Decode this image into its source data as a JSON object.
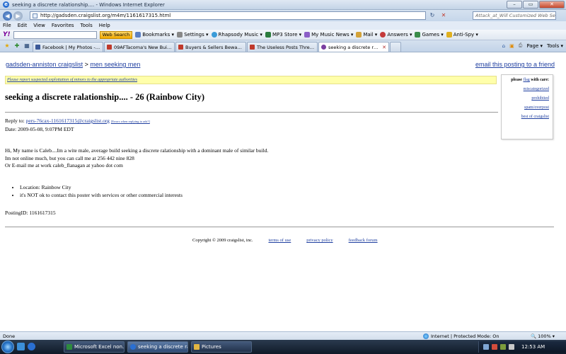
{
  "window": {
    "title": "seeking a discrete ralationship.... - Windows Internet Explorer",
    "min": "–",
    "max": "▭",
    "close": "✕"
  },
  "address": {
    "url": "http://gadsden.craigslist.org/m4m/1161617315.html",
    "search_placeholder": "Attack_at_Will Customized Web Search"
  },
  "menu": [
    "File",
    "Edit",
    "View",
    "Favorites",
    "Tools",
    "Help"
  ],
  "toolbar": {
    "search_button": "Web Search",
    "items": [
      "Bookmarks ▾",
      "Settings ▾",
      "Rhapsody Music ▾",
      "MP3 Store ▾",
      "My Music News ▾",
      "Mail ▾",
      "Answers ▾",
      "Games ▾",
      "Anti-Spy ▾"
    ]
  },
  "tabs": [
    {
      "label": "Facebook | My Photos - Pr..."
    },
    {
      "label": "09AFTacoma's New Build...."
    },
    {
      "label": "Buyers & Sellers Beware of..."
    },
    {
      "label": "The Useless Posts Thread -..."
    },
    {
      "label": "seeking a discrete ralati..."
    }
  ],
  "command_bar": [
    "Page ▾",
    "Tools ▾"
  ],
  "page": {
    "breadcrumb_city": "gadsden-anniston craigslist",
    "breadcrumb_sep": " > ",
    "breadcrumb_section": "men seeking men",
    "email_link": "email this posting to a friend",
    "warning": "Please report suspected exploitation of minors to the appropriate authorities",
    "title": "seeking a discrete ralationship.... - 26 (Rainbow City)",
    "reply_label": "Reply to: ",
    "reply_email": "pers-76cax-1161617315@craigslist.org",
    "reply_note": "[Errors when replying to ads?]",
    "date": "Date: 2009-05-08, 9:07PM EDT",
    "body": [
      "Hi, My name is Caleb....Im a wite male, average build seeking a discrete ralationship with a dominant male of similar build.",
      "Im not online much, but you can call me at 256 442 nine 828",
      "Or E-mail me at work caleb_flanagan at yahoo dot com"
    ],
    "bullets": [
      "Location: Rainbow City",
      "it's NOT ok to contact this poster with services or other commercial interests"
    ],
    "posting_id": "PostingID: 1161617315",
    "copyright": "Copyright © 2009 craigslist, inc.",
    "footer_links": [
      "terms of use",
      "privacy policy",
      "feedback forum"
    ],
    "flag": {
      "head_pre": "please ",
      "head_link": "flag",
      "head_post": " with care:",
      "options": [
        "miscategorized",
        "prohibited",
        "spam/overpost",
        "best of craigslist"
      ]
    }
  },
  "status": {
    "left": "Done",
    "zone": "Internet | Protected Mode: On",
    "zoom": "🔍 100% ▾"
  },
  "taskbar": {
    "buttons": [
      "Microsoft Excel non...",
      "seeking a discrete ra...",
      "Pictures"
    ],
    "clock": "12:53 AM"
  }
}
